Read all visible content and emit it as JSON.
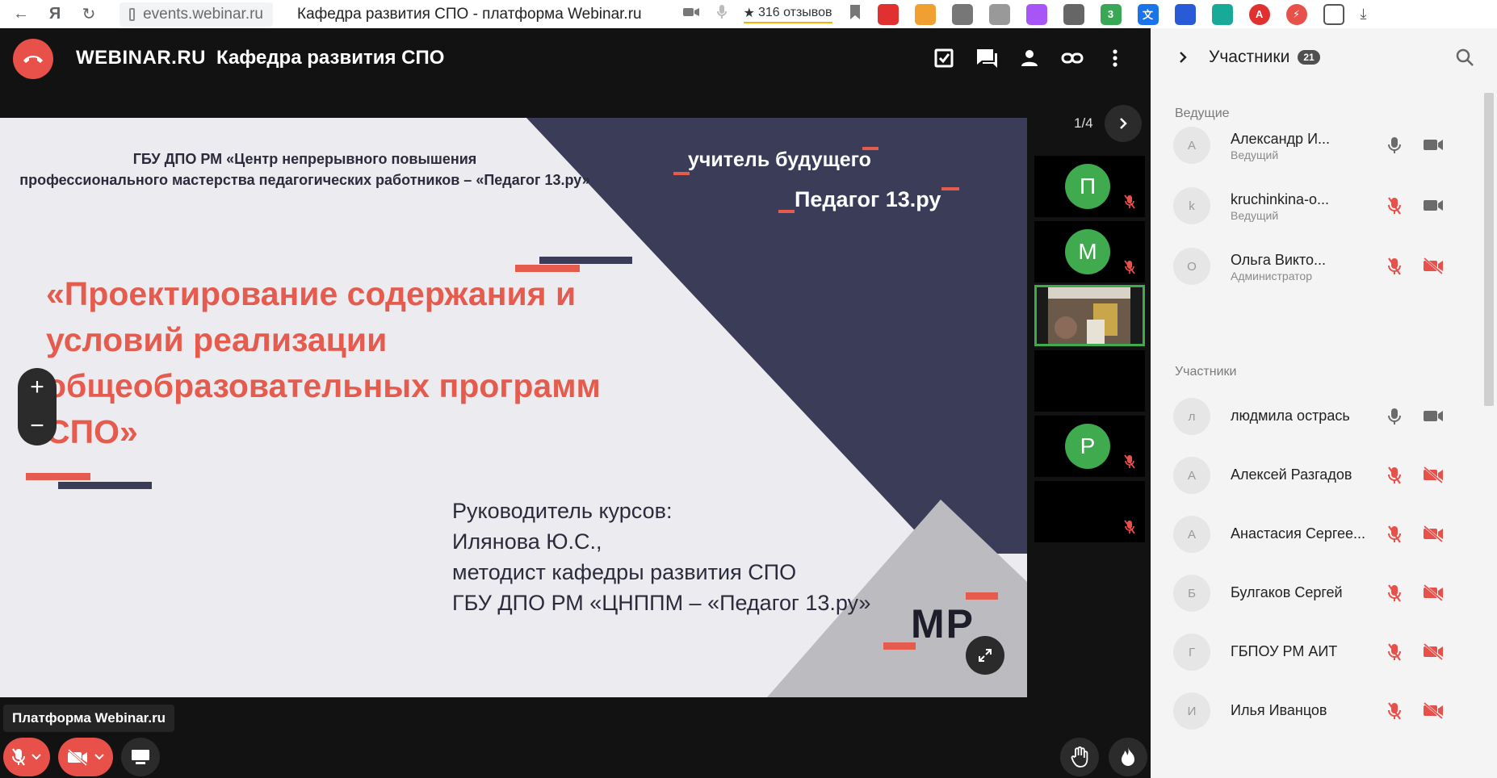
{
  "browser": {
    "url": "events.webinar.ru",
    "page_title": "Кафедра развития СПО - платформа Webinar.ru",
    "reviews": "316 отзывов",
    "ext_badge": "3"
  },
  "topbar": {
    "brand": "WEBINAR.RU",
    "room_title": "Кафедра развития СПО"
  },
  "slide": {
    "org_line1": "ГБУ ДПО РМ  «Центр непрерывного повышения",
    "org_line2": "профессионального мастерства педагогических работников – «Педагог 13.ру»",
    "tag1": "учитель будущего",
    "tag2": "Педагог 13.ру",
    "main_line1": "«Проектирование содержания и",
    "main_line2": "условий реализации",
    "main_line3": "общеобразовательных программ",
    "main_line4": "СПО»",
    "info_line1": "Руководитель курсов:",
    "info_line2": "Илянова Ю.С.,",
    "info_line3": "методист кафедры развития СПО",
    "info_line4": "ГБУ ДПО РМ «ЦНППМ – «Педагог 13.ру»",
    "logo": "МР",
    "accent_color": "#e55b4d",
    "dark_color": "#3a3c58"
  },
  "zoom": {
    "plus": "+",
    "minus": "−"
  },
  "video_grid": {
    "page": "1/4",
    "tiles": [
      {
        "initial": "П",
        "muted": true
      },
      {
        "initial": "М",
        "muted": true
      },
      {
        "initial": "",
        "muted": false,
        "video": true
      },
      {
        "initial": "",
        "muted": false
      },
      {
        "initial": "Р",
        "muted": true
      },
      {
        "initial": "",
        "muted": true
      }
    ]
  },
  "bottom": {
    "tooltip": "Платформа Webinar.ru"
  },
  "panel": {
    "title": "Участники",
    "count": "21",
    "hosts_label": "Ведущие",
    "participants_label": "Участники",
    "hosts": [
      {
        "initial": "А",
        "name": "Александр И...",
        "role": "Ведущий",
        "mic": "on",
        "cam": "on"
      },
      {
        "initial": "k",
        "name": "kruchinkina-o...",
        "role": "Ведущий",
        "mic": "off",
        "cam": "on"
      },
      {
        "initial": "О",
        "name": "Ольга Викто...",
        "role": "Администратор",
        "mic": "off",
        "cam": "off"
      }
    ],
    "participants": [
      {
        "initial": "л",
        "name": "людмила острась",
        "mic": "on",
        "cam": "on"
      },
      {
        "initial": "А",
        "name": "Алексей Разгадов",
        "mic": "off",
        "cam": "off"
      },
      {
        "initial": "А",
        "name": "Анастасия Сергее...",
        "mic": "off",
        "cam": "off"
      },
      {
        "initial": "Б",
        "name": "Булгаков Сергей",
        "mic": "off",
        "cam": "off"
      },
      {
        "initial": "Г",
        "name": "ГБПОУ РМ АИТ",
        "mic": "off",
        "cam": "off"
      },
      {
        "initial": "И",
        "name": "Илья Иванцов",
        "mic": "off",
        "cam": "off"
      }
    ],
    "mic_on_color": "#6b6b6b",
    "mic_off_color": "#e8504a"
  }
}
